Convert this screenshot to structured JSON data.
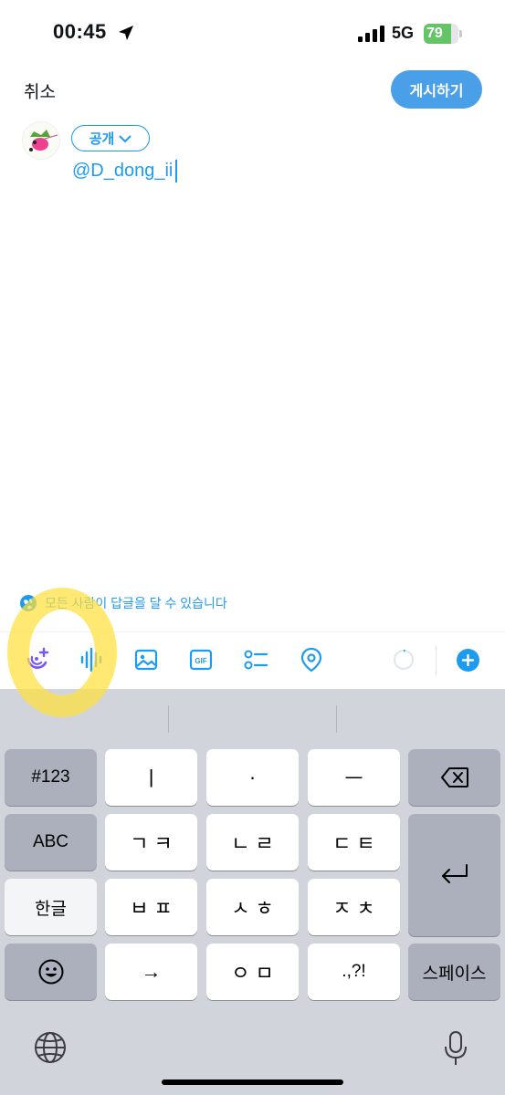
{
  "status_bar": {
    "time": "00:45",
    "network": "5G",
    "battery": 79,
    "battery_text": "79",
    "icons": [
      "location-arrow-icon",
      "signal-bars-icon",
      "battery-charging-icon"
    ]
  },
  "header": {
    "cancel_label": "취소",
    "post_label": "게시하기"
  },
  "compose": {
    "audience_label": "공개",
    "text": "@D_dong_ii"
  },
  "reply_settings": {
    "label": "모든 사람이 답글을 달 수 있습니다",
    "icon": "globe-icon"
  },
  "toolbar": {
    "icons": [
      "spaces-add-icon",
      "voice-waveform-icon",
      "image-icon",
      "gif-icon",
      "poll-icon",
      "location-pin-icon",
      "character-progress-ring",
      "add-thread-plus-icon"
    ],
    "gif_label": "GIF"
  },
  "keyboard": {
    "rows": [
      [
        "#123",
        "ㅣ",
        "·",
        "ㅡ",
        "⌫"
      ],
      [
        "ABC",
        "ㄱㅋ",
        "ㄴㄹ",
        "ㄷㅌ",
        "↵"
      ],
      [
        "한글",
        "ㅂㅍ",
        "ㅅㅎ",
        "ㅈㅊ"
      ],
      [
        "☺",
        "→",
        "ㅇㅁ",
        ".,?!",
        "스페이스"
      ]
    ],
    "key_123": "#123",
    "key_i": "ㅣ",
    "key_dot": "·",
    "key_eu": "ㅡ",
    "key_abc": "ABC",
    "key_gk": "ㄱ ㅋ",
    "key_nr": "ㄴ ㄹ",
    "key_dt": "ㄷ ㅌ",
    "key_hangul": "한글",
    "key_bp": "ㅂ ㅍ",
    "key_sh": "ㅅ ㅎ",
    "key_jch": "ㅈ ㅊ",
    "key_arrow": "→",
    "key_om": "ㅇ ㅁ",
    "key_punct": ".,?!",
    "key_space": "스페이스"
  },
  "colors": {
    "accent": "#1d9bf0",
    "post_button": "#4a9fe9",
    "battery_green": "#65c466",
    "highlight": "#ffe13c",
    "keyboard_bg": "#d1d4db"
  }
}
